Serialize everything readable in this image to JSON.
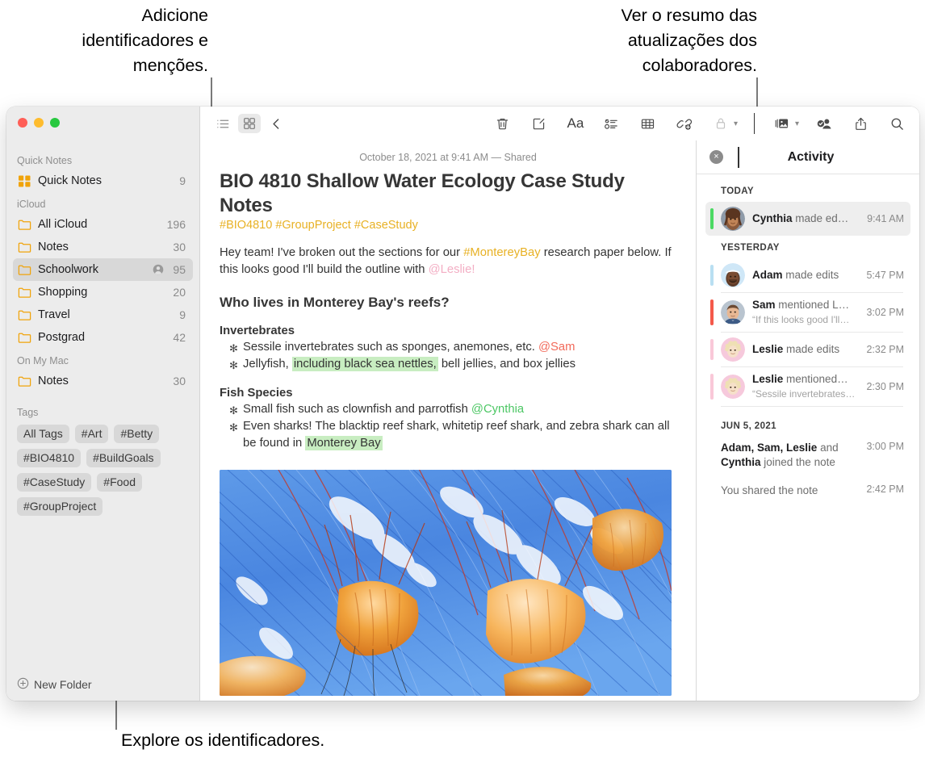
{
  "callouts": {
    "top_left": "Adicione\nidentificadores e\nmenções.",
    "top_right": "Ver o resumo das\natualizações dos\ncolaboradores.",
    "bottom_left": "Explore os identificadores."
  },
  "sidebar": {
    "groups": [
      {
        "title": "Quick Notes",
        "items": [
          {
            "label": "Quick Notes",
            "count": "9",
            "icon": "quicknote-grid-icon",
            "selected": false,
            "shared": false
          }
        ]
      },
      {
        "title": "iCloud",
        "items": [
          {
            "label": "All iCloud",
            "count": "196",
            "icon": "folder-icon",
            "selected": false,
            "shared": false
          },
          {
            "label": "Notes",
            "count": "30",
            "icon": "folder-icon",
            "selected": false,
            "shared": false
          },
          {
            "label": "Schoolwork",
            "count": "95",
            "icon": "folder-icon",
            "selected": true,
            "shared": true
          },
          {
            "label": "Shopping",
            "count": "20",
            "icon": "folder-icon",
            "selected": false,
            "shared": false
          },
          {
            "label": "Travel",
            "count": "9",
            "icon": "folder-icon",
            "selected": false,
            "shared": false
          },
          {
            "label": "Postgrad",
            "count": "42",
            "icon": "folder-icon",
            "selected": false,
            "shared": false
          }
        ]
      },
      {
        "title": "On My Mac",
        "items": [
          {
            "label": "Notes",
            "count": "30",
            "icon": "folder-icon",
            "selected": false,
            "shared": false
          }
        ]
      }
    ],
    "tags_title": "Tags",
    "tags": [
      "All Tags",
      "#Art",
      "#Betty",
      "#BIO4810",
      "#BuildGoals",
      "#CaseStudy",
      "#Food",
      "#GroupProject"
    ],
    "new_folder_label": "New Folder"
  },
  "toolbar": {
    "list_view_label": "list-view",
    "gallery_view_label": "gallery-view",
    "back_label": "back",
    "delete_label": "delete",
    "compose_label": "new-note",
    "format_label": "Aa",
    "checklist_label": "checklist",
    "table_label": "table",
    "link_label": "add-link",
    "lock_label": "lock",
    "media_label": "media",
    "collaborate_label": "collaborate",
    "share_label": "share",
    "search_label": "search"
  },
  "note": {
    "date": "October 18, 2021 at 9:41 AM — Shared",
    "title": "BIO 4810 Shallow Water Ecology Case Study Notes",
    "tags_line": "#BIO4810 #GroupProject #CaseStudy",
    "intro": {
      "part1": "Hey team! I've broken out the sections for our ",
      "tag": "#MontereyBay",
      "part2": " research paper below. If this looks good I'll build the outline with ",
      "mention": "@Leslie!"
    },
    "heading": "Who lives in Monterey Bay's reefs?",
    "sections": [
      {
        "subheading": "Invertebrates",
        "bullets": [
          {
            "pre": "Sessile invertebrates such as sponges, anemones, etc. ",
            "mention": "@Sam",
            "mention_color": "red",
            "post": "",
            "highlight": "",
            "tail": ""
          },
          {
            "pre": "Jellyfish, ",
            "mention": "",
            "mention_color": "",
            "highlight": "including black sea nettles,",
            "tail": " bell jellies, and box jellies",
            "post": ""
          }
        ]
      },
      {
        "subheading": "Fish Species",
        "bullets": [
          {
            "pre": "Small fish such as clownfish and parrotfish ",
            "mention": "@Cynthia",
            "mention_color": "green",
            "post": "",
            "highlight": "",
            "tail": ""
          },
          {
            "pre": "Even sharks! The blacktip reef shark, whitetip reef shark, and zebra shark can all be found in ",
            "mention": "",
            "mention_color": "",
            "highlight": "Monterey Bay",
            "tail": "",
            "post": ""
          }
        ]
      }
    ],
    "image_alt": "jellyfish-photo"
  },
  "activity": {
    "title": "Activity",
    "close_label": "×",
    "sections": [
      {
        "header": "TODAY",
        "rows": [
          {
            "name": "Cynthia",
            "action": " made ed…",
            "quote": "",
            "time": "9:41 AM",
            "bar_color": "#4bd963",
            "avatar": "cynthia",
            "selected": true
          }
        ]
      },
      {
        "header": "YESTERDAY",
        "rows": [
          {
            "name": "Adam",
            "action": " made edits",
            "quote": "",
            "time": "5:47 PM",
            "bar_color": "#b9dff2",
            "avatar": "adam",
            "selected": false
          },
          {
            "name": "Sam",
            "action": " mentioned L…",
            "quote": "“If this looks good I'll…",
            "time": "3:02 PM",
            "bar_color": "#f4594a",
            "avatar": "sam",
            "selected": false
          },
          {
            "name": "Leslie",
            "action": " made edits",
            "quote": "",
            "time": "2:32 PM",
            "bar_color": "#f9c8d8",
            "avatar": "leslie",
            "selected": false
          },
          {
            "name": "Leslie",
            "action": " mentioned…",
            "quote": "“Sessile invertebrates…",
            "time": "2:30 PM",
            "bar_color": "#f9c8d8",
            "avatar": "leslie",
            "selected": false
          }
        ]
      }
    ],
    "older": {
      "header": "JUN 5, 2021",
      "rows": [
        {
          "bold1": "Adam, Sam, Leslie",
          "mid": " and ",
          "bold2": "Cynthia",
          "tail": " joined the note",
          "time": "3:00 PM"
        },
        {
          "bold1": "",
          "mid": "You shared the note",
          "bold2": "",
          "tail": "",
          "time": "2:42 PM"
        }
      ]
    }
  },
  "colors": {
    "accent_orange": "#f0a30a",
    "tag_yellow": "#e8b124",
    "highlight_green": "#c8edc1",
    "mention_red": "#f26a5a",
    "mention_green": "#4cc764",
    "mention_pink": "#f3aec4"
  }
}
